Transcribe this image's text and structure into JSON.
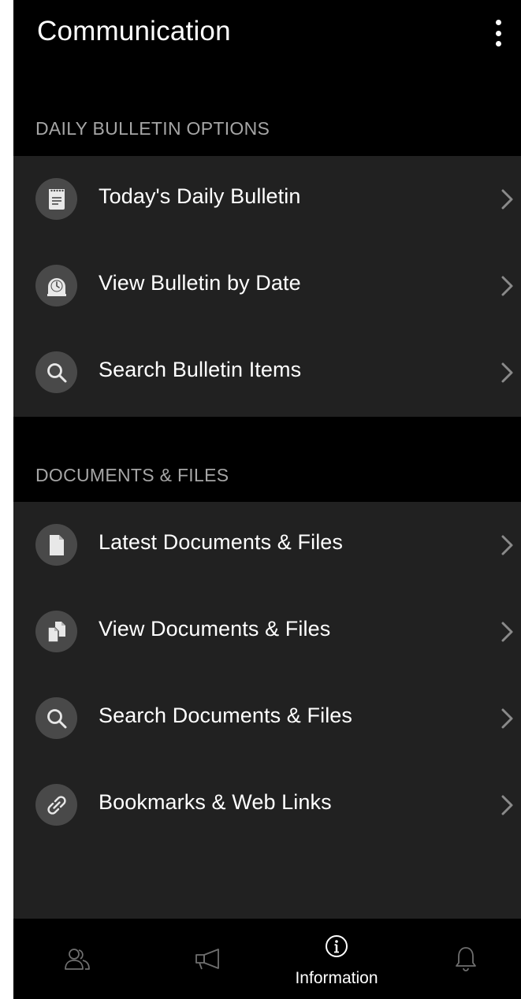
{
  "header": {
    "title": "Communication",
    "menu_icon": "more-vertical-icon"
  },
  "sections": [
    {
      "label": "DAILY BULLETIN OPTIONS",
      "items": [
        {
          "label": "Today's Daily Bulletin",
          "icon": "notepad-icon"
        },
        {
          "label": "View Bulletin by Date",
          "icon": "clock-icon"
        },
        {
          "label": "Search Bulletin Items",
          "icon": "search-icon"
        }
      ]
    },
    {
      "label": "DOCUMENTS & FILES",
      "items": [
        {
          "label": "Latest Documents & Files",
          "icon": "document-icon"
        },
        {
          "label": "View Documents & Files",
          "icon": "documents-icon"
        },
        {
          "label": "Search Documents & Files",
          "icon": "search-icon"
        },
        {
          "label": "Bookmarks & Web Links",
          "icon": "link-icon"
        }
      ]
    }
  ],
  "bottom_nav": {
    "items": [
      {
        "icon": "people-icon",
        "label": ""
      },
      {
        "icon": "megaphone-icon",
        "label": ""
      },
      {
        "icon": "info-icon",
        "label": "Information",
        "active": true
      },
      {
        "icon": "bell-icon",
        "label": ""
      }
    ]
  },
  "colors": {
    "background": "#000000",
    "group_background": "#212121",
    "icon_circle": "#494949",
    "section_label": "#a6a6a6",
    "text": "#ffffff",
    "chevron": "#8a8a8a",
    "nav_inactive": "#6f6f6f"
  }
}
